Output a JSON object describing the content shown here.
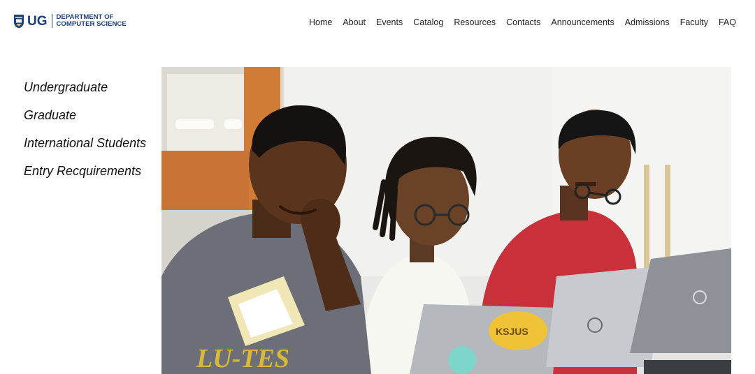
{
  "header": {
    "logo": {
      "ug": "UG",
      "dept_line1": "DEPARTMENT OF",
      "dept_line2": "COMPUTER SCIENCE",
      "crest_icon": "university-crest-icon"
    },
    "nav": [
      {
        "label": "Home"
      },
      {
        "label": "About"
      },
      {
        "label": "Events"
      },
      {
        "label": "Catalog"
      },
      {
        "label": "Resources"
      },
      {
        "label": "Contacts"
      },
      {
        "label": "Announcements"
      },
      {
        "label": "Admissions"
      },
      {
        "label": "Faculty"
      },
      {
        "label": "FAQ"
      }
    ]
  },
  "sidebar": {
    "items": [
      {
        "label": "Undergraduate"
      },
      {
        "label": "Graduate"
      },
      {
        "label": "International Students"
      },
      {
        "label": "Entry Recquirements"
      }
    ]
  },
  "hero": {
    "shirt_text": "LU-TES",
    "sticker_text": "KSJUS"
  },
  "colors": {
    "brand": "#1c3f78",
    "nav_text": "#222222",
    "sidebar_text": "#111111"
  }
}
